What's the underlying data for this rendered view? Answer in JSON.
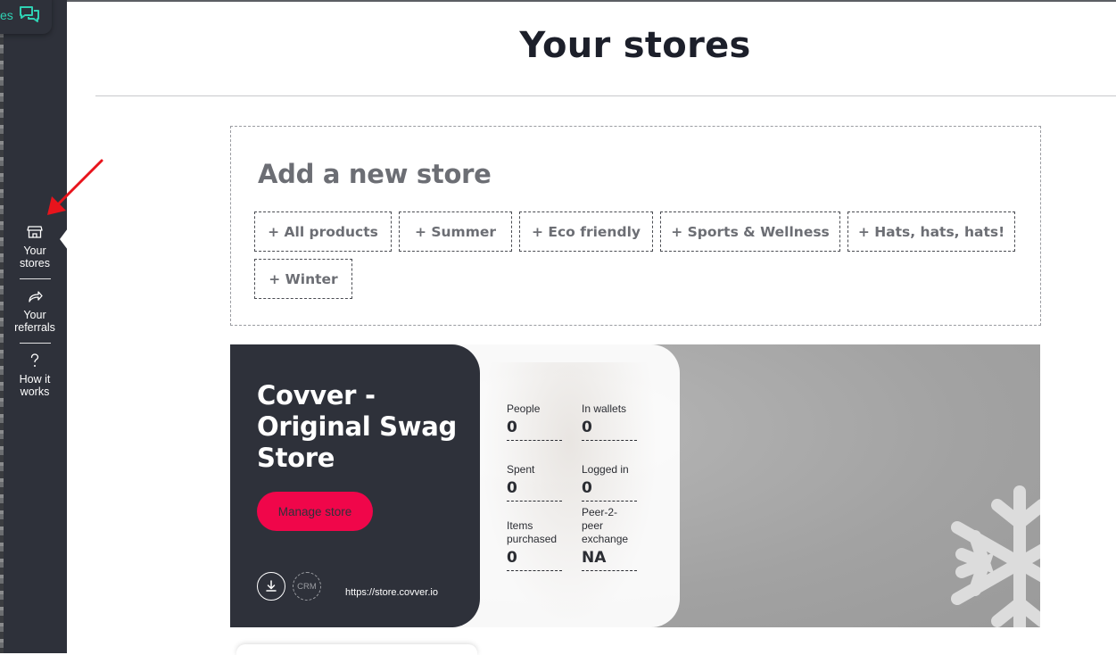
{
  "colors": {
    "sidebar": "#2e313a",
    "accent_teal": "#2fd1b3",
    "manage_button": "#f0064a",
    "annotation_arrow": "#e8141c"
  },
  "messages_pill": {
    "label": "es",
    "icon": "chat-bubbles-icon"
  },
  "sidebar": {
    "items": [
      {
        "label_line1": "Your",
        "label_line2": "stores",
        "icon": "storefront-icon",
        "active": true
      },
      {
        "label_line1": "Your",
        "label_line2": "referrals",
        "icon": "share-arrow-icon"
      },
      {
        "label_line1": "How it",
        "label_line2": "works",
        "icon": "question-mark-icon"
      }
    ]
  },
  "page": {
    "title": "Your stores"
  },
  "add_store": {
    "heading": "Add a new store",
    "templates": [
      "+ All products",
      "+ Summer",
      "+ Eco friendly",
      "+ Sports & Wellness",
      "+ Hats, hats, hats!",
      "+ Winter"
    ]
  },
  "store": {
    "name": "Covver - Original Swag Store",
    "manage_label": "Manage store",
    "crm_label": "CRM",
    "download_icon": "download-icon",
    "url": "https://store.covver.io",
    "stats": [
      {
        "label": "People",
        "value": "0"
      },
      {
        "label": "In wallets",
        "value": "0"
      },
      {
        "label": "Spent",
        "value": "0"
      },
      {
        "label": "Logged in",
        "value": "0"
      },
      {
        "label": "Items purchased",
        "value": "0"
      },
      {
        "label": "Peer-2-peer exchange",
        "value": "NA"
      }
    ]
  }
}
